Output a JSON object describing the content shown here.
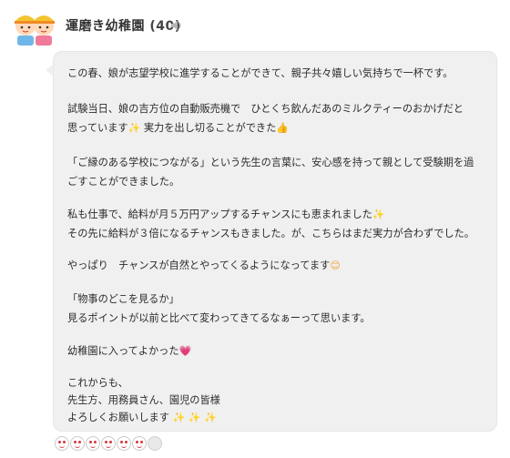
{
  "header": {
    "name": "運磨き幼稚園",
    "count": "(40)"
  },
  "post": {
    "lines": [
      "この春、娘が志望学校に進学することができて、親子共々嬉しい気持ちで一杯です。",
      "試験当日、娘の吉方位の自動販売機で　ひとくち飲んだあのミルクティーのおかげだと",
      "思っています",
      "実力を出し切ることができた",
      "「ご縁のある学校につながる」という先生の言葉に、安心感を持って親として受験期を過",
      "ごすことができました。",
      "私も仕事で、給料が月５万円アップするチャンスにも恵まれました",
      "その先に給料が３倍になるチャンスもきました。が、こちらはまだ実力が合わずでした。",
      "やっぱり　チャンスが自然とやってくるようになってます",
      "「物事のどこを見るか」",
      "見るポイントが以前と比べて変わってきてるなぁーって思います。",
      "幼稚園に入ってよかった",
      "これからも、",
      "先生方、用務員さん、園児の皆様",
      "よろしくお願いします"
    ],
    "emoji": {
      "sparkle": "✨",
      "thumb": "👍",
      "smile": "😊",
      "heart": "💗"
    }
  },
  "reactions": {
    "icon": "smiley-reaction-icon",
    "count_shown": 6
  }
}
